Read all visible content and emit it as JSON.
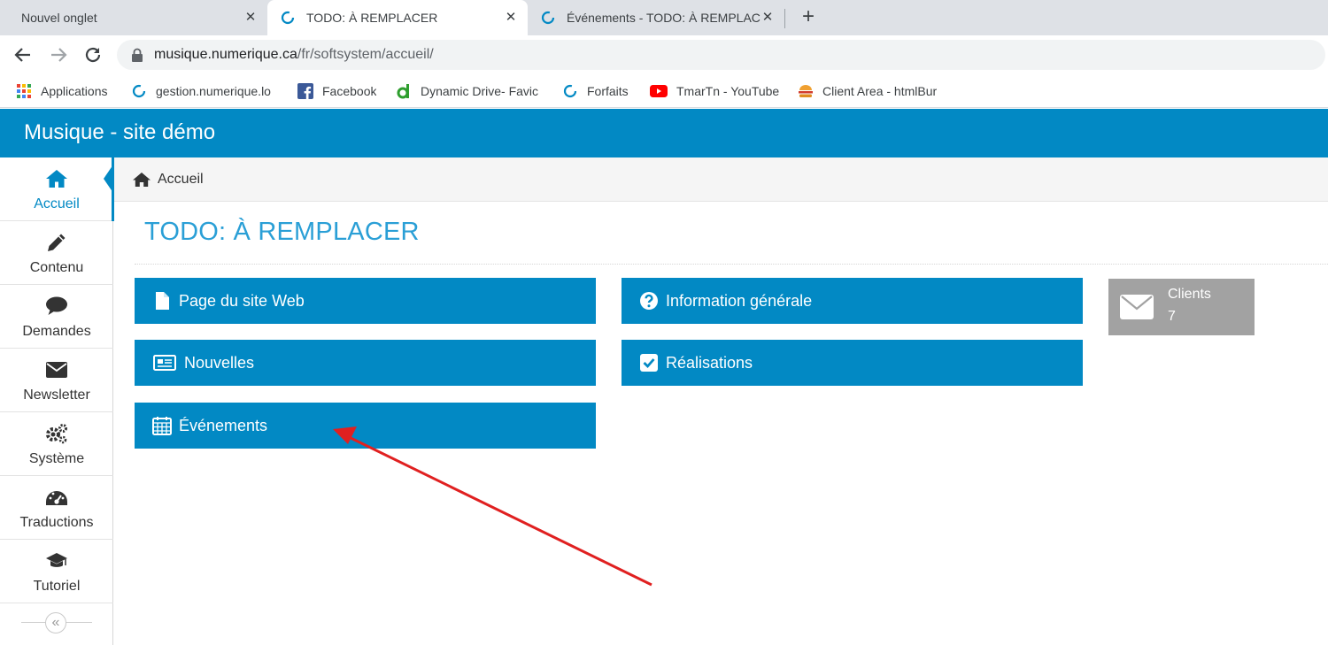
{
  "browser": {
    "tabs": [
      {
        "label": "Nouvel onglet"
      },
      {
        "label": "TODO: À REMPLACER"
      },
      {
        "label": "Événements - TODO: À REMPLAC"
      }
    ],
    "new_tab": "+",
    "close_glyph": "✕",
    "url_host": "musique.numerique.ca",
    "url_path": "/fr/softsystem/accueil/",
    "bookmarks": [
      {
        "label": "Applications",
        "icon": "apps-grid-icon"
      },
      {
        "label": "gestion.numerique.lo",
        "icon": "ring-favicon-icon"
      },
      {
        "label": "Facebook",
        "icon": "facebook-icon"
      },
      {
        "label": "Dynamic Drive- Favic",
        "icon": "dynamic-drive-icon"
      },
      {
        "label": "Forfaits",
        "icon": "ring-favicon-icon"
      },
      {
        "label": "TmarTn - YouTube",
        "icon": "youtube-icon"
      },
      {
        "label": "Client Area - htmlBur",
        "icon": "burger-icon"
      }
    ]
  },
  "app": {
    "title": "Musique - site démo",
    "accent_color": "#0289c4",
    "sidebar": {
      "items": [
        {
          "label": "Accueil",
          "icon": "home-icon",
          "active": true
        },
        {
          "label": "Contenu",
          "icon": "pencil-icon"
        },
        {
          "label": "Demandes",
          "icon": "comment-icon"
        },
        {
          "label": "Newsletter",
          "icon": "envelope-icon"
        },
        {
          "label": "Système",
          "icon": "cogs-icon"
        },
        {
          "label": "Traductions",
          "icon": "dashboard-icon"
        },
        {
          "label": "Tutoriel",
          "icon": "graduation-cap-icon"
        }
      ],
      "collapse_glyph": "«"
    },
    "breadcrumb": "Accueil",
    "page_title": "TODO: À REMPLACER",
    "tiles": [
      {
        "label": "Page du site Web",
        "icon": "file-icon"
      },
      {
        "label": "Nouvelles",
        "icon": "newspaper-icon"
      },
      {
        "label": "Événements",
        "icon": "calendar-icon"
      },
      {
        "label": "Information générale",
        "icon": "question-circle-icon"
      },
      {
        "label": "Réalisations",
        "icon": "check-square-icon"
      }
    ],
    "stat": {
      "label": "Clients",
      "value": "7",
      "icon": "envelope-icon"
    }
  },
  "annotation": {
    "arrow_color": "#e02020",
    "points_to": "Événements"
  }
}
